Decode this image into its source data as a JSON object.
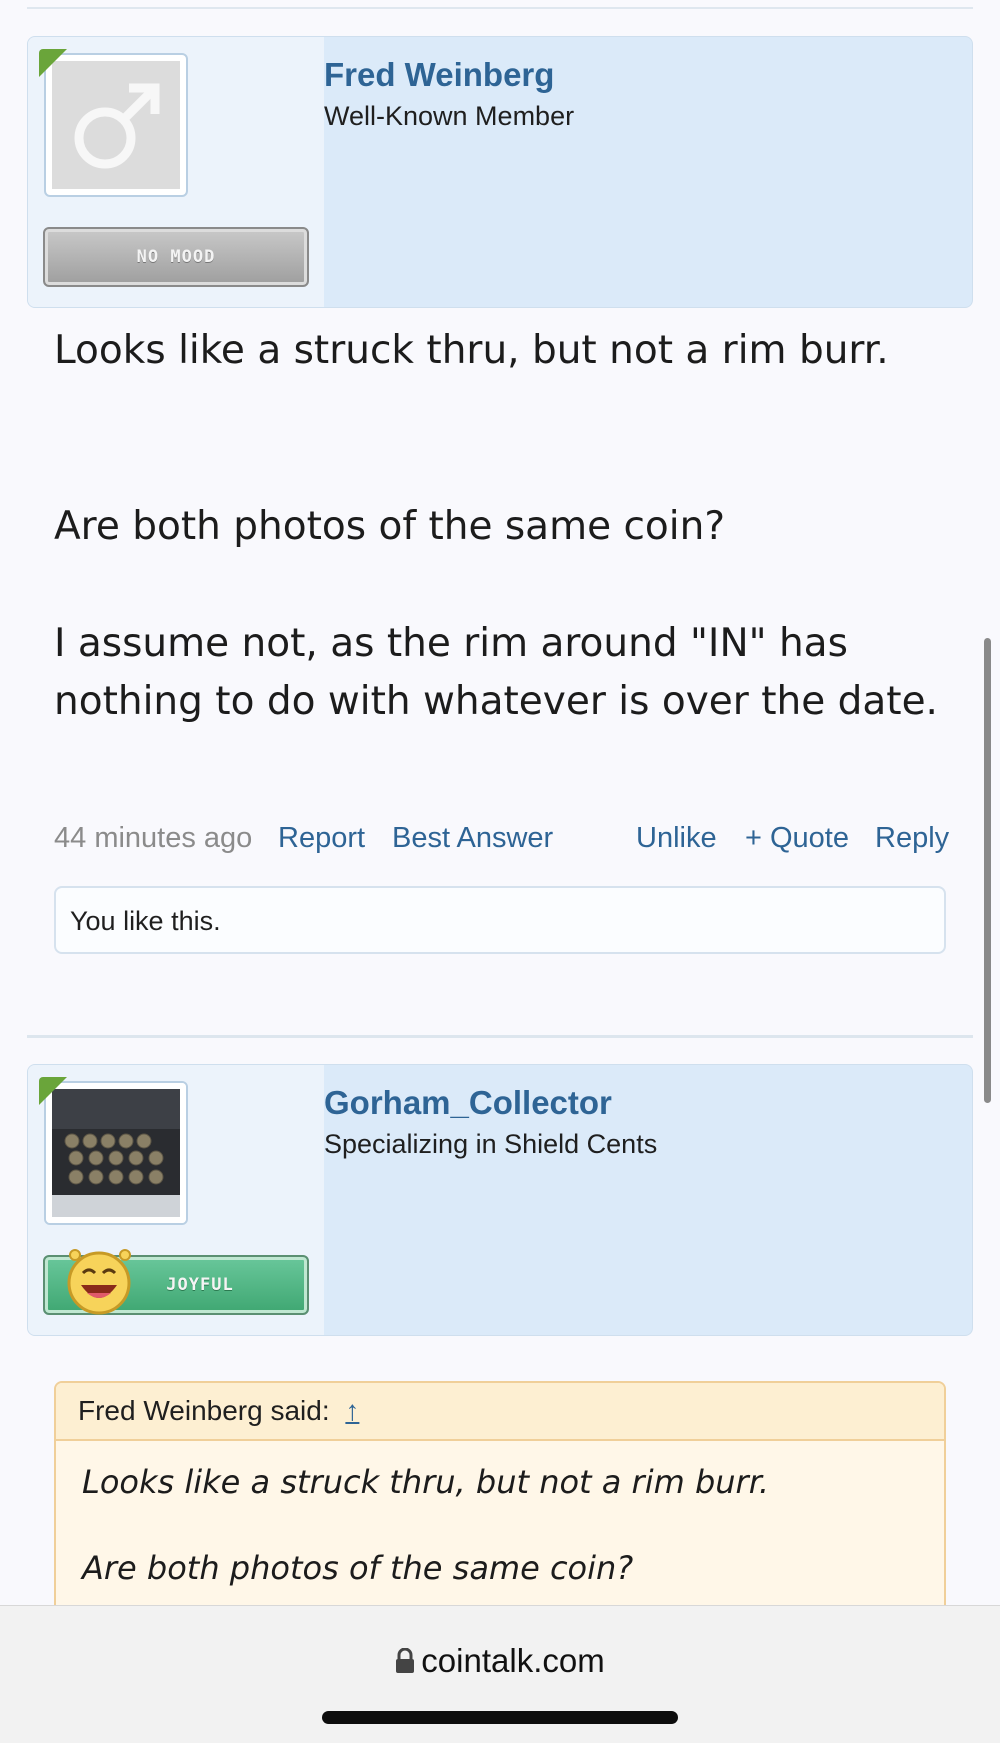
{
  "post1": {
    "username": "Fred Weinberg",
    "user_title": "Well-Known Member",
    "mood": "NO MOOD",
    "paragraphs": [
      "Looks like a struck thru, but not a rim burr.",
      "Are both photos of the same coin?",
      "I assume not, as the rim around \"IN\" has nothing to do with whatever is over the date."
    ],
    "time": "44 minutes ago",
    "actions": {
      "report": "Report",
      "best_answer": "Best Answer",
      "unlike": "Unlike",
      "quote": "+ Quote",
      "reply": "Reply"
    },
    "likes": "You like this."
  },
  "post2": {
    "username": "Gorham_Collector",
    "user_title": "Specializing in Shield Cents",
    "mood": "JOYFUL",
    "quote": {
      "header": "Fred Weinberg said:",
      "arrow": "↑",
      "lines": [
        "Looks like a struck thru, but not a rim burr.",
        "Are both photos of the same coin?"
      ]
    }
  },
  "browser": {
    "url": "cointalk.com"
  },
  "icons": {
    "avatar1": "male-symbol-icon",
    "avatar2": "coin-case-photo",
    "mood2": "joyful-smiley-icon",
    "lock": "lock-icon"
  },
  "colors": {
    "link": "#2e6495",
    "userbar_bg": "#dbeaf9",
    "quote_bg": "#fff7e8",
    "online": "#6aa53a"
  }
}
